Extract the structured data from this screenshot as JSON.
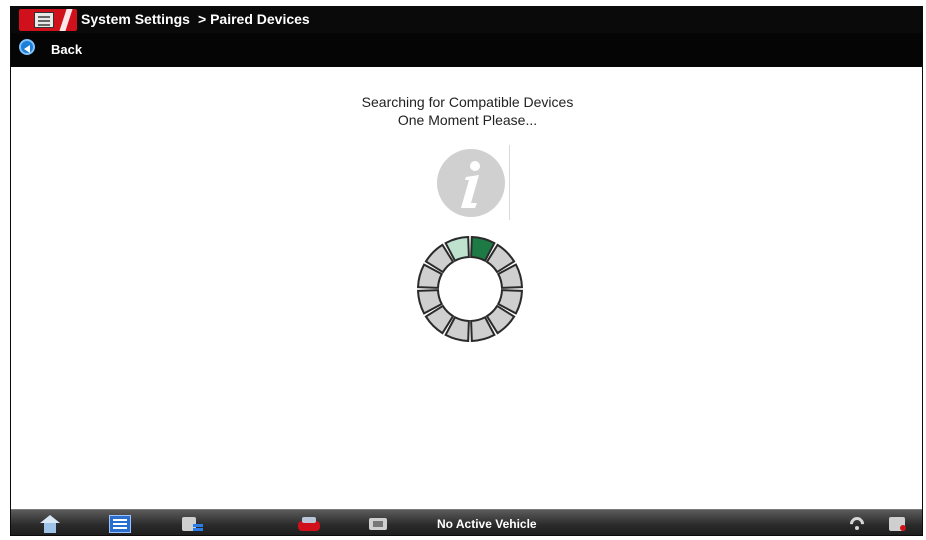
{
  "header": {
    "title": "System Settings",
    "breadcrumb": "> Paired Devices",
    "back_label": "Back"
  },
  "main": {
    "status_line1": "Searching for Compatible Devices",
    "status_line2": "One Moment Please...",
    "icons": {
      "info": "info-icon",
      "spinner": "loading-spinner-icon"
    }
  },
  "bottom_bar": {
    "vehicle_status": "No Active Vehicle",
    "icons": [
      "home-icon",
      "list-icon",
      "tools-icon",
      "vehicle-icon",
      "scanner-icon",
      "wifi-icon",
      "device-icon"
    ]
  },
  "colors": {
    "title_bar": "#0a0a0a",
    "brand_red": "#d0101a",
    "spinner_active": "#1e7a45",
    "spinner_trail": "#bfe2cf",
    "spinner_idle": "#cfcfcf"
  }
}
